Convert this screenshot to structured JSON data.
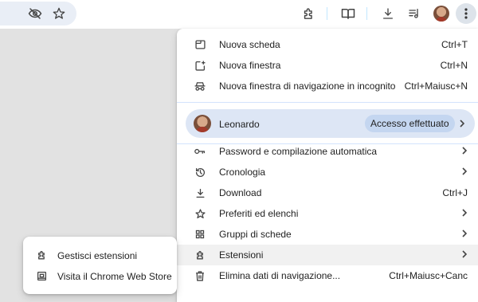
{
  "toolbar": {
    "icons": [
      "eye-off-icon",
      "star-icon",
      "extensions-icon",
      "reading-mode-icon",
      "download-icon",
      "media-queue-icon",
      "avatar",
      "more-vert-icon"
    ]
  },
  "menu": {
    "items_top": [
      {
        "label": "Nuova scheda",
        "shortcut": "Ctrl+T",
        "icon": "new-tab-icon"
      },
      {
        "label": "Nuova finestra",
        "shortcut": "Ctrl+N",
        "icon": "new-window-icon"
      },
      {
        "label": "Nuova finestra di navigazione in incognito",
        "shortcut": "Ctrl+Maiusc+N",
        "icon": "incognito-icon"
      }
    ],
    "profile": {
      "name": "Leonardo",
      "status": "Accesso effettuato"
    },
    "items_bottom": [
      {
        "label": "Password e compilazione automatica",
        "shortcut": "",
        "submenu": true,
        "icon": "key-icon"
      },
      {
        "label": "Cronologia",
        "shortcut": "",
        "submenu": true,
        "icon": "history-icon"
      },
      {
        "label": "Download",
        "shortcut": "Ctrl+J",
        "submenu": false,
        "icon": "download-icon"
      },
      {
        "label": "Preferiti ed elenchi",
        "shortcut": "",
        "submenu": true,
        "icon": "star-icon"
      },
      {
        "label": "Gruppi di schede",
        "shortcut": "",
        "submenu": true,
        "icon": "tab-groups-icon"
      },
      {
        "label": "Estensioni",
        "shortcut": "",
        "submenu": true,
        "icon": "extensions-icon",
        "highlighted": true
      },
      {
        "label": "Elimina dati di navigazione...",
        "shortcut": "Ctrl+Maiusc+Canc",
        "submenu": false,
        "icon": "trash-icon"
      }
    ]
  },
  "submenu": {
    "items": [
      {
        "label": "Gestisci estensioni",
        "icon": "extensions-icon"
      },
      {
        "label": "Visita il Chrome Web Store",
        "icon": "web-store-icon"
      }
    ]
  },
  "colors": {
    "accent_bg": "#dde6f5",
    "status_chip": "#c4d6f0",
    "divider": "#d3e3fd",
    "page_bg": "#e2e2e2"
  }
}
